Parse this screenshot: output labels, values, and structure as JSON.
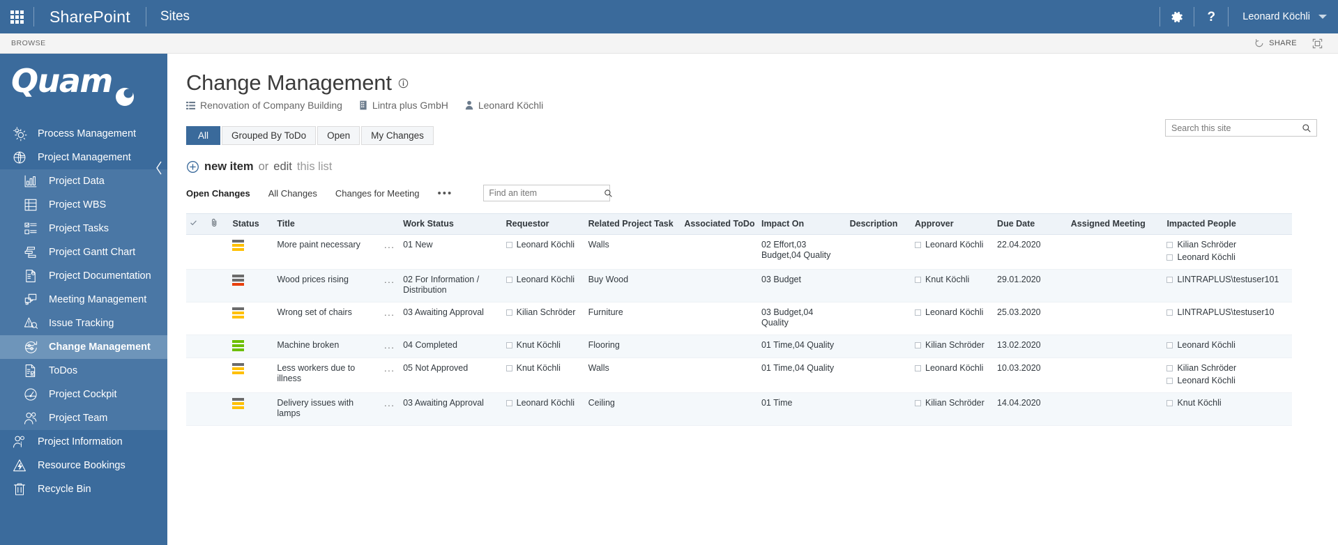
{
  "suite": {
    "waffle_icon": "app-launcher-icon",
    "brand": "SharePoint",
    "site_nav": "Sites",
    "settings_icon": "gear-icon",
    "help_icon": "help-icon",
    "user_name": "Leonard Köchli",
    "user_caret_icon": "chevron-down-icon"
  },
  "ribbon": {
    "browse_tab": "BROWSE",
    "share_label": "SHARE",
    "share_icon": "share-icon",
    "focus_icon": "focus-on-content-icon"
  },
  "sidebar": {
    "logo_text": "Quam",
    "logo_mark_icon": "quam-dot-icon",
    "collapse_icon": "chevron-left-icon",
    "items": [
      {
        "label": "Process Management",
        "icon": "gears-icon",
        "level": "top",
        "active": false
      },
      {
        "label": "Project Management",
        "icon": "globe-folder-icon",
        "level": "top",
        "active": false
      },
      {
        "label": "Project Data",
        "icon": "bar-chart-icon",
        "level": "sub",
        "active": false
      },
      {
        "label": "Project WBS",
        "icon": "wbs-icon",
        "level": "sub",
        "active": false
      },
      {
        "label": "Project Tasks",
        "icon": "checklist-icon",
        "level": "sub",
        "active": false
      },
      {
        "label": "Project Gantt Chart",
        "icon": "gantt-icon",
        "level": "sub",
        "active": false
      },
      {
        "label": "Project Documentation",
        "icon": "document-icon",
        "level": "sub",
        "active": false
      },
      {
        "label": "Meeting Management",
        "icon": "meeting-icon",
        "level": "sub",
        "active": false
      },
      {
        "label": "Issue Tracking",
        "icon": "issue-warning-icon",
        "level": "sub",
        "active": false
      },
      {
        "label": "Change Management",
        "icon": "change-sliders-icon",
        "level": "sub",
        "active": true
      },
      {
        "label": "ToDos",
        "icon": "todo-doc-icon",
        "level": "sub",
        "active": false
      },
      {
        "label": "Project Cockpit",
        "icon": "gauge-icon",
        "level": "sub",
        "active": false
      },
      {
        "label": "Project Team",
        "icon": "people-icon",
        "level": "sub",
        "active": false
      },
      {
        "label": "Project Information",
        "icon": "person-info-icon",
        "level": "top",
        "active": false
      },
      {
        "label": "Resource Bookings",
        "icon": "bolt-warning-icon",
        "level": "top",
        "active": false
      },
      {
        "label": "Recycle Bin",
        "icon": "trash-icon",
        "level": "top",
        "active": false
      }
    ]
  },
  "search": {
    "placeholder": "Search this site",
    "value": "",
    "icon": "search-icon"
  },
  "page": {
    "title": "Change Management",
    "title_info_icon": "info-icon",
    "breadcrumb": [
      {
        "label": "Renovation of Company Building",
        "icon": "list-icon"
      },
      {
        "label": "Lintra plus GmbH",
        "icon": "building-icon"
      },
      {
        "label": "Leonard Köchli",
        "icon": "person-icon"
      }
    ]
  },
  "view_tabs": [
    {
      "label": "All",
      "active": true
    },
    {
      "label": "Grouped By ToDo",
      "active": false
    },
    {
      "label": "Open",
      "active": false
    },
    {
      "label": "My Changes",
      "active": false
    }
  ],
  "new_item": {
    "plus_icon": "plus-circle-icon",
    "new_item_label": "new item",
    "or_label": "or",
    "edit_label": "edit",
    "this_list_label": "this list"
  },
  "list_toolbar": {
    "links": [
      {
        "label": "Open Changes",
        "active": true
      },
      {
        "label": "All Changes",
        "active": false
      },
      {
        "label": "Changes for Meeting",
        "active": false
      }
    ],
    "ellipsis": "•••",
    "find": {
      "placeholder": "Find an item",
      "value": "",
      "icon": "search-icon"
    }
  },
  "table": {
    "columns": [
      "",
      "",
      "Status",
      "Title",
      "",
      "Work Status",
      "Requestor",
      "Related Project Task",
      "Associated ToDo",
      "Impact On",
      "Description",
      "Approver",
      "Due Date",
      "Assigned Meeting",
      "Impacted People"
    ],
    "header_check_icon": "checkmark-icon",
    "header_clip_icon": "paperclip-icon",
    "rows": [
      {
        "status_bars": [
          "#6b6b6b",
          "#ffc000",
          "#ffc000"
        ],
        "title": "More paint necessary",
        "row_menu": "...",
        "work_status": "01 New",
        "requestor": [
          "Leonard Köchli"
        ],
        "related_task": "Walls",
        "associated_todo": "",
        "impact_on": "02 Effort,03 Budget,04 Quality",
        "description": "",
        "approver": [
          "Leonard Köchli"
        ],
        "due_date": "22.04.2020",
        "assigned_meeting": "",
        "impacted_people": [
          "Kilian Schröder",
          "Leonard Köchli"
        ]
      },
      {
        "status_bars": [
          "#6b6b6b",
          "#6b6b6b",
          "#e8400c"
        ],
        "title": "Wood prices rising",
        "row_menu": "...",
        "work_status": "02 For Information / Distribution",
        "requestor": [
          "Leonard Köchli"
        ],
        "related_task": "Buy Wood",
        "associated_todo": "",
        "impact_on": "03 Budget",
        "description": "",
        "approver": [
          "Knut Köchli"
        ],
        "due_date": "29.01.2020",
        "assigned_meeting": "",
        "impacted_people": [
          "LINTRAPLUS\\testuser101"
        ]
      },
      {
        "status_bars": [
          "#6b6b6b",
          "#ffc000",
          "#ffc000"
        ],
        "title": "Wrong set of chairs",
        "row_menu": "...",
        "work_status": "03 Awaiting Approval",
        "requestor": [
          "Kilian Schröder"
        ],
        "related_task": "Furniture",
        "associated_todo": "",
        "impact_on": "03 Budget,04 Quality",
        "description": "",
        "approver": [
          "Leonard Köchli"
        ],
        "due_date": "25.03.2020",
        "assigned_meeting": "",
        "impacted_people": [
          "LINTRAPLUS\\testuser10"
        ]
      },
      {
        "status_bars": [
          "#6cbe00",
          "#6cbe00",
          "#6cbe00"
        ],
        "title": "Machine broken",
        "row_menu": "...",
        "work_status": "04 Completed",
        "requestor": [
          "Knut Köchli"
        ],
        "related_task": "Flooring",
        "associated_todo": "",
        "impact_on": "01 Time,04 Quality",
        "description": "",
        "approver": [
          "Kilian Schröder"
        ],
        "due_date": "13.02.2020",
        "assigned_meeting": "",
        "impacted_people": [
          "Leonard Köchli"
        ]
      },
      {
        "status_bars": [
          "#6b6b6b",
          "#ffc000",
          "#ffc000"
        ],
        "title": "Less workers due to illness",
        "row_menu": "...",
        "work_status": "05 Not Approved",
        "requestor": [
          "Knut Köchli"
        ],
        "related_task": "Walls",
        "associated_todo": "",
        "impact_on": "01 Time,04 Quality",
        "description": "",
        "approver": [
          "Leonard Köchli"
        ],
        "due_date": "10.03.2020",
        "assigned_meeting": "",
        "impacted_people": [
          "Kilian Schröder",
          "Leonard Köchli"
        ]
      },
      {
        "status_bars": [
          "#6b6b6b",
          "#ffc000",
          "#ffc000"
        ],
        "title": "Delivery issues with lamps",
        "row_menu": "...",
        "work_status": "03 Awaiting Approval",
        "requestor": [
          "Leonard Köchli"
        ],
        "related_task": "Ceiling",
        "associated_todo": "",
        "impact_on": "01 Time",
        "description": "",
        "approver": [
          "Kilian Schröder"
        ],
        "due_date": "14.04.2020",
        "assigned_meeting": "",
        "impacted_people": [
          "Knut Köchli"
        ]
      }
    ]
  },
  "colors": {
    "suite_bar": "#3a6a9b",
    "sidebar": "#3b6b9c",
    "sidebar_group": "#4a77a5",
    "sidebar_active": "#6e95ba",
    "header_row": "#eef3f8",
    "alt_row": "#f4f8fb"
  }
}
